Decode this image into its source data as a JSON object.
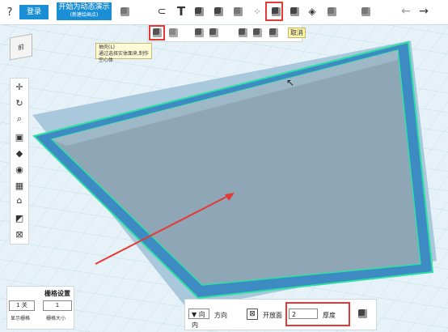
{
  "toolbar": {
    "button_ok": "登录",
    "button_shell": "开始为动态演示",
    "button_shell_sub": "(新建绘画点)",
    "icons": [
      "help-icon",
      "login-button",
      "shell-button",
      "layer-icon",
      "magnet-icon",
      "text-icon",
      "extrude-icon",
      "box-icon",
      "revolve-icon",
      "pattern-icon",
      "shell-icon",
      "cube-icon",
      "fillet-icon",
      "chamfer-icon",
      "mirror-icon",
      "undo-icon",
      "redo-icon"
    ]
  },
  "subbar": {
    "cancel_label": "取消"
  },
  "tooltip": {
    "title": "抽壳(L)",
    "body": "通过选择实体面来,制作空心体"
  },
  "viewcube": {
    "label": "前"
  },
  "gridpanel": {
    "title": "栅格设置",
    "value_left": "1 关",
    "value_right": "1",
    "label_left": "显示栅格",
    "label_right": "栅格大小"
  },
  "bottompanel": {
    "thickness_label": "厚度",
    "thickness_value": "2",
    "open_face_label": "开放面",
    "direction_label": "方向",
    "direction_value": "向内"
  },
  "colors": {
    "accent": "#1b8fd6",
    "highlight": "#e53935",
    "shell_outer": "#3e8bc4",
    "shell_inner": "#8ea6b5",
    "edge": "#2fe0a5"
  }
}
